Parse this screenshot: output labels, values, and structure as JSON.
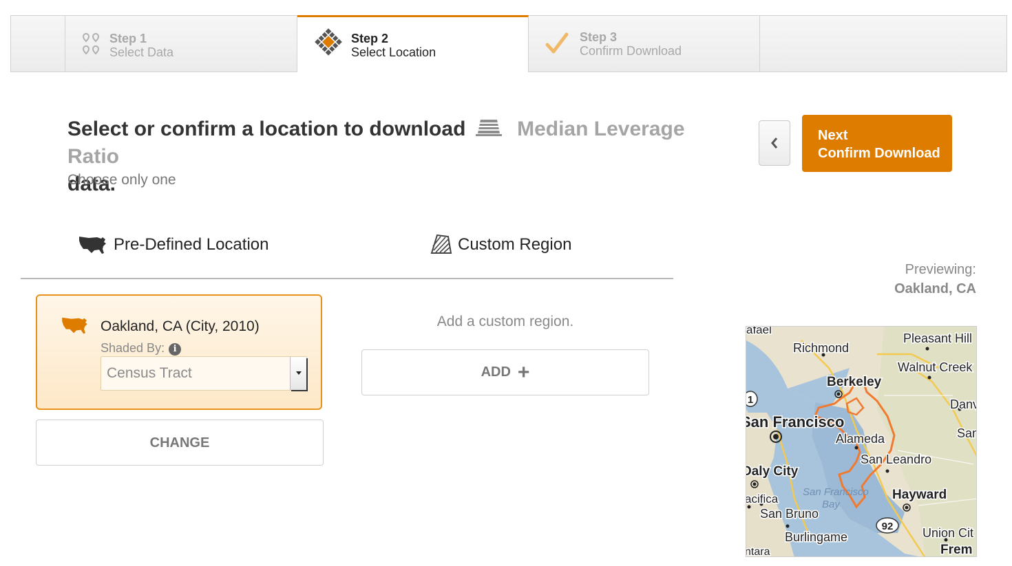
{
  "stepper": {
    "steps": [
      {
        "num": "Step 1",
        "label": "Select Data",
        "state": "done"
      },
      {
        "num": "Step 2",
        "label": "Select Location",
        "state": "active"
      },
      {
        "num": "Step 3",
        "label": "Confirm Download",
        "state": "pending"
      }
    ]
  },
  "header": {
    "title": "Select or confirm a location to download",
    "dataset": "Median Leverage Ratio",
    "title_tail": "data.",
    "subtitle": "Choose only one"
  },
  "actions": {
    "back_icon": "chevron-left-icon",
    "next_line1": "Next",
    "next_line2": "Confirm Download"
  },
  "tabs": {
    "predefined": "Pre-Defined Location",
    "custom": "Custom Region"
  },
  "location": {
    "name": "Oakland, CA (City, 2010)",
    "shaded_by_label": "Shaded By:",
    "shaded_by_value": "Census Tract",
    "change_label": "CHANGE"
  },
  "custom": {
    "hint": "Add a custom region.",
    "add_label": "ADD"
  },
  "preview": {
    "label": "Previewing:",
    "location": "Oakland, CA"
  },
  "map": {
    "labels": {
      "rafael": "afael",
      "richmond": "Richmond",
      "pleasant_hill": "Pleasant Hill",
      "walnut_creek": "Walnut Creek",
      "berkeley": "Berkeley",
      "danville": "Danvil",
      "san_francisco": "San Francisco",
      "alameda": "Alameda",
      "san_ramon": "San R",
      "san_leandro": "San Leandro",
      "daly_city": "Daly City",
      "sf_bay_1": "San Francisco",
      "sf_bay_2": "Bay",
      "hayward": "Hayward",
      "pacifica": "acifica",
      "san_bruno": "San Bruno",
      "route_92": "92",
      "route_1": "1",
      "burlingame": "Burlingame",
      "union_city": "Union Cit",
      "fremont": "Frem",
      "montara": "ntara"
    }
  },
  "colors": {
    "accent": "#de7c00",
    "map_water": "#a8c4dc",
    "boundary": "#f07a30"
  }
}
